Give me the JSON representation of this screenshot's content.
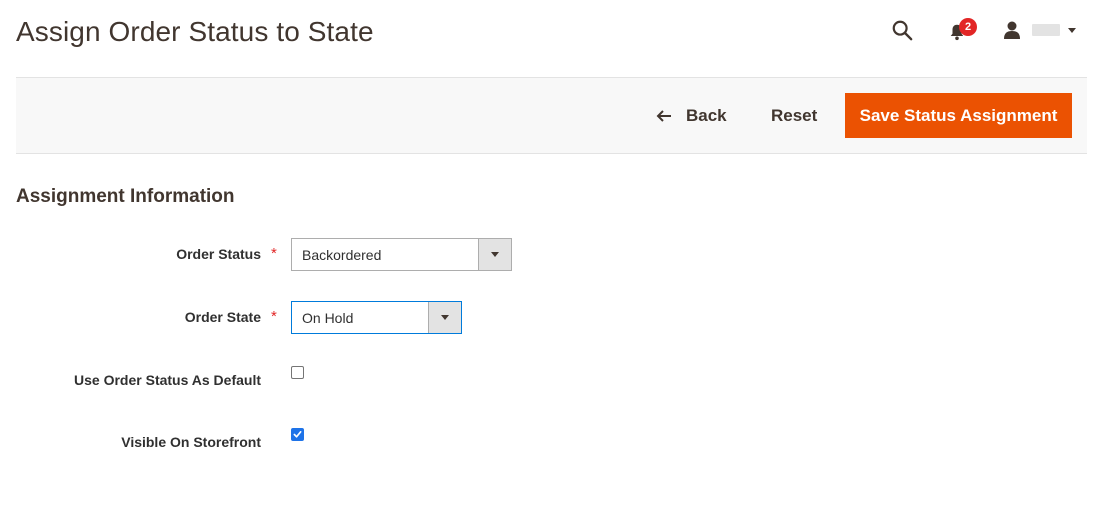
{
  "header": {
    "title": "Assign Order Status to State",
    "notifications_count": "2"
  },
  "actions": {
    "back_label": "Back",
    "reset_label": "Reset",
    "save_label": "Save Status Assignment"
  },
  "form": {
    "section_title": "Assignment Information",
    "order_status": {
      "label": "Order Status",
      "value": "Backordered",
      "required": true
    },
    "order_state": {
      "label": "Order State",
      "value": "On Hold",
      "required": true
    },
    "use_as_default": {
      "label": "Use Order Status As Default",
      "checked": false
    },
    "visible_on_storefront": {
      "label": "Visible On Storefront",
      "checked": true
    },
    "required_marker": "*"
  },
  "colors": {
    "accent": "#eb5202",
    "badge": "#e22626",
    "checkbox_checked": "#1e73e8",
    "focus_border": "#007bdb"
  }
}
